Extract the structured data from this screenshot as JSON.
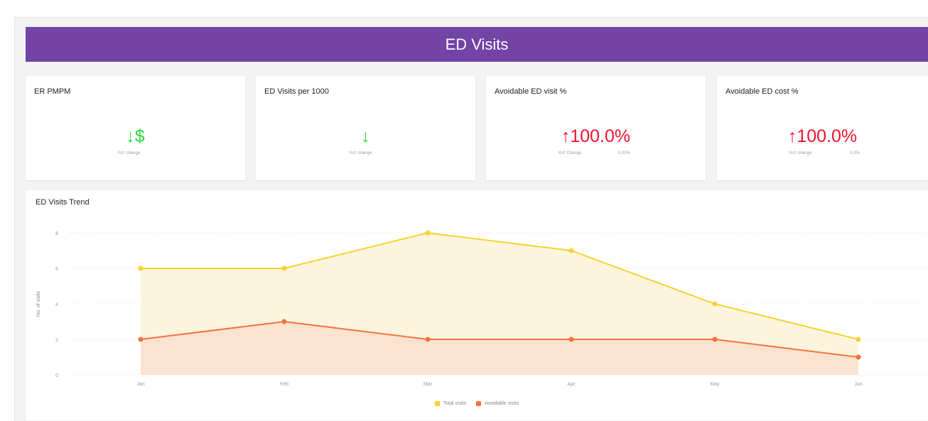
{
  "header": {
    "title": "ED Visits"
  },
  "cards": [
    {
      "title": "ER PMPM",
      "value": "↓$",
      "change_label": "YoY change",
      "change_value": ""
    },
    {
      "title": "ED Visits per 1000",
      "value": "↓",
      "change_label": "YoY change",
      "change_value": ""
    },
    {
      "title": "Avoidable ED visit %",
      "value": "↑100.0%",
      "change_label": "YoY Change",
      "change_value": "0.00%"
    },
    {
      "title": "Avoidable ED cost %",
      "value": "↑100.0%",
      "change_label": "YoY change",
      "change_value": "0.0%"
    }
  ],
  "colors": {
    "header": "#7343a5",
    "down": "#2bd93a",
    "up": "#f0132f",
    "total": "#f6d232",
    "total_fill": "#fdf4dd",
    "avoidable": "#f3733f",
    "avoidable_fill": "#fce3cf"
  },
  "chart_data": {
    "type": "area",
    "title": "ED Visits Trend",
    "ylabel": "No. of visits",
    "xlabel": "",
    "categories": [
      "Jan",
      "Feb",
      "Mar",
      "Apr",
      "May",
      "Jun"
    ],
    "y_ticks": [
      "0",
      "2",
      "4",
      "6",
      "8"
    ],
    "ylim": [
      0,
      8
    ],
    "grid": true,
    "legend": "bottom",
    "series": [
      {
        "name": "Total visits",
        "values": [
          6,
          6,
          8,
          7,
          4,
          2
        ]
      },
      {
        "name": "Avoidable visits",
        "values": [
          2,
          3,
          2,
          2,
          2,
          1
        ]
      }
    ]
  }
}
